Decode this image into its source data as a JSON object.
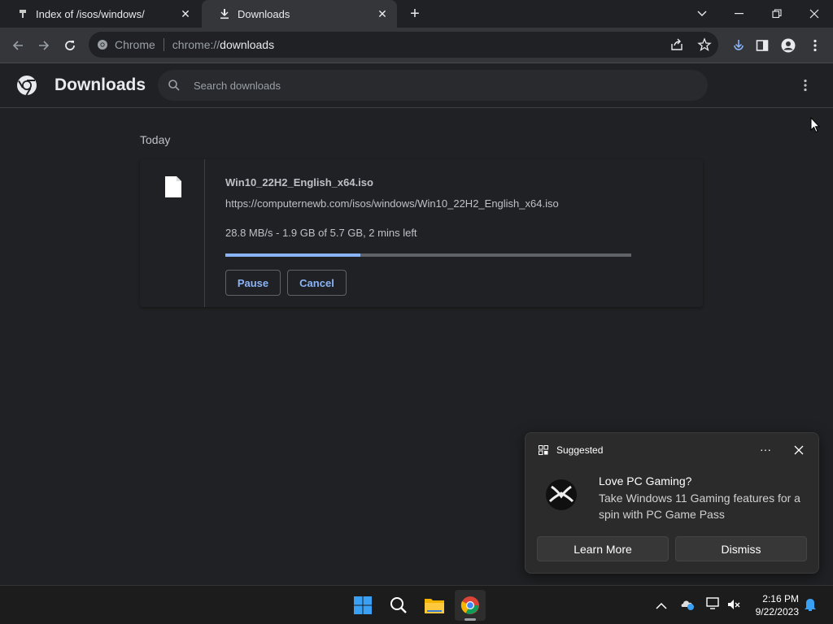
{
  "tabs": [
    {
      "label": "Index of /isos/windows/",
      "icon": "web-icon"
    },
    {
      "label": "Downloads",
      "icon": "download-icon"
    }
  ],
  "window_controls": {
    "dropdown": "tab-search-icon",
    "minimize": "minimize-icon",
    "restore": "restore-icon",
    "close": "close-icon"
  },
  "omnibox": {
    "chip_label": "Chrome",
    "url_scheme": "chrome://",
    "url_host": "downloads"
  },
  "header": {
    "title": "Downloads",
    "search_placeholder": "Search downloads"
  },
  "downloads": {
    "date_group": "Today",
    "item": {
      "filename": "Win10_22H2_English_x64.iso",
      "url": "https://computernewb.com/isos/windows/Win10_22H2_English_x64.iso",
      "status": "28.8 MB/s - 1.9 GB of 5.7 GB, 2 mins left",
      "progress_fraction": 0.333,
      "pause_label": "Pause",
      "cancel_label": "Cancel"
    }
  },
  "notification": {
    "header": "Suggested",
    "title": "Love PC Gaming?",
    "body": "Take Windows 11 Gaming features for a spin with PC Game Pass",
    "learn_more_label": "Learn More",
    "dismiss_label": "Dismiss"
  },
  "taskbar": {
    "time": "2:16 PM",
    "date": "9/22/2023"
  },
  "colors": {
    "accent": "#8ab4f8",
    "background": "#202124",
    "toolbar": "#35363a"
  }
}
